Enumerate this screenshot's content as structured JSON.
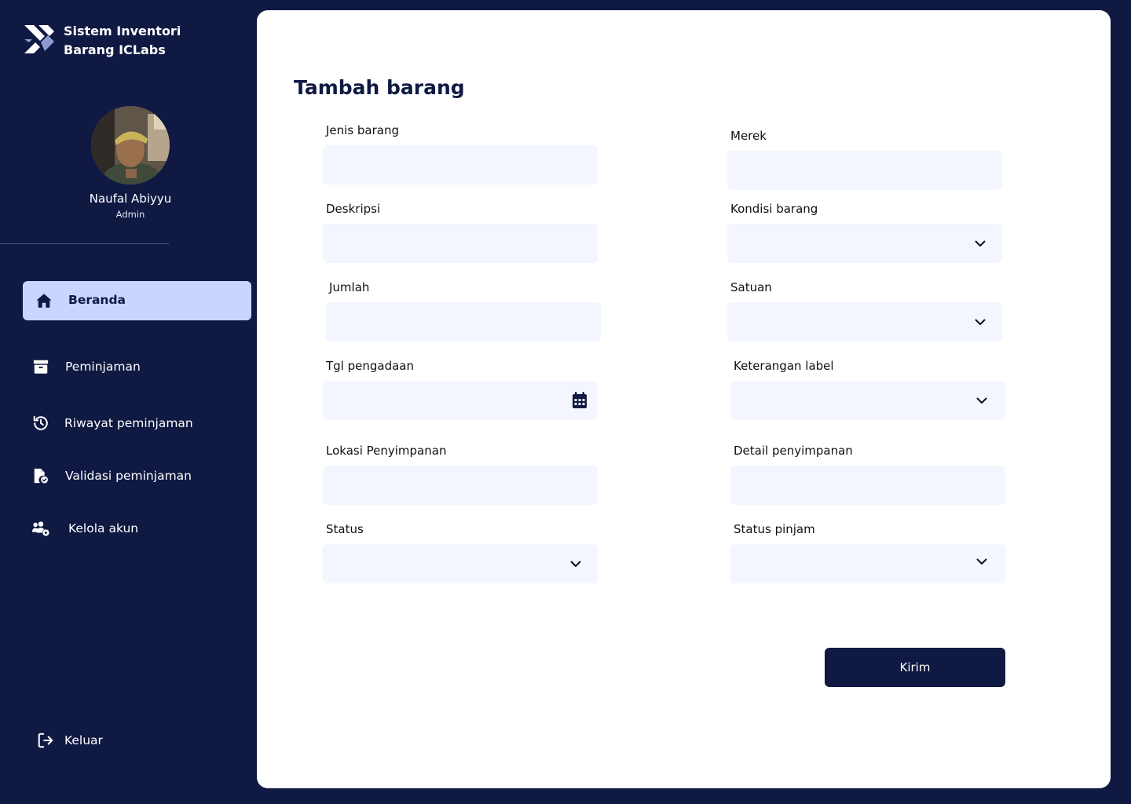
{
  "app": {
    "title_line1": "Sistem Inventori",
    "title_line2": "Barang ICLabs"
  },
  "user": {
    "name": "Naufal Abiyyu",
    "role": "Admin"
  },
  "nav": {
    "items": [
      {
        "label": "Beranda",
        "icon": "home-icon",
        "active": true
      },
      {
        "label": "Peminjaman",
        "icon": "box-icon"
      },
      {
        "label": "Riwayat peminjaman",
        "icon": "history-icon"
      },
      {
        "label": "Validasi peminjaman",
        "icon": "file-check-icon"
      },
      {
        "label": "Kelola akun",
        "icon": "users-gear-icon"
      }
    ],
    "logout": {
      "label": "Keluar",
      "icon": "logout-icon"
    }
  },
  "form": {
    "title": "Tambah barang",
    "fields": {
      "jenis_barang": {
        "label": "Jenis barang",
        "value": ""
      },
      "merek": {
        "label": "Merek",
        "value": ""
      },
      "deskripsi": {
        "label": "Deskripsi",
        "value": ""
      },
      "kondisi_barang": {
        "label": "Kondisi barang",
        "value": ""
      },
      "jumlah": {
        "label": "Jumlah",
        "value": ""
      },
      "satuan": {
        "label": "Satuan",
        "value": ""
      },
      "tgl_pengadaan": {
        "label": "Tgl pengadaan",
        "value": ""
      },
      "keterangan_label": {
        "label": "Keterangan label",
        "value": ""
      },
      "lokasi_penyimpanan": {
        "label": "Lokasi Penyimpanan",
        "value": ""
      },
      "detail_penyimpanan": {
        "label": "Detail penyimpanan",
        "value": ""
      },
      "status": {
        "label": "Status",
        "value": ""
      },
      "status_pinjam": {
        "label": "Status pinjam",
        "value": ""
      }
    },
    "submit_label": "Kirim"
  },
  "colors": {
    "sidebar_bg": "#0f1942",
    "active_nav_bg": "#c9d5fd",
    "field_bg": "#f3f6fe",
    "button_bg": "#0f1942"
  }
}
